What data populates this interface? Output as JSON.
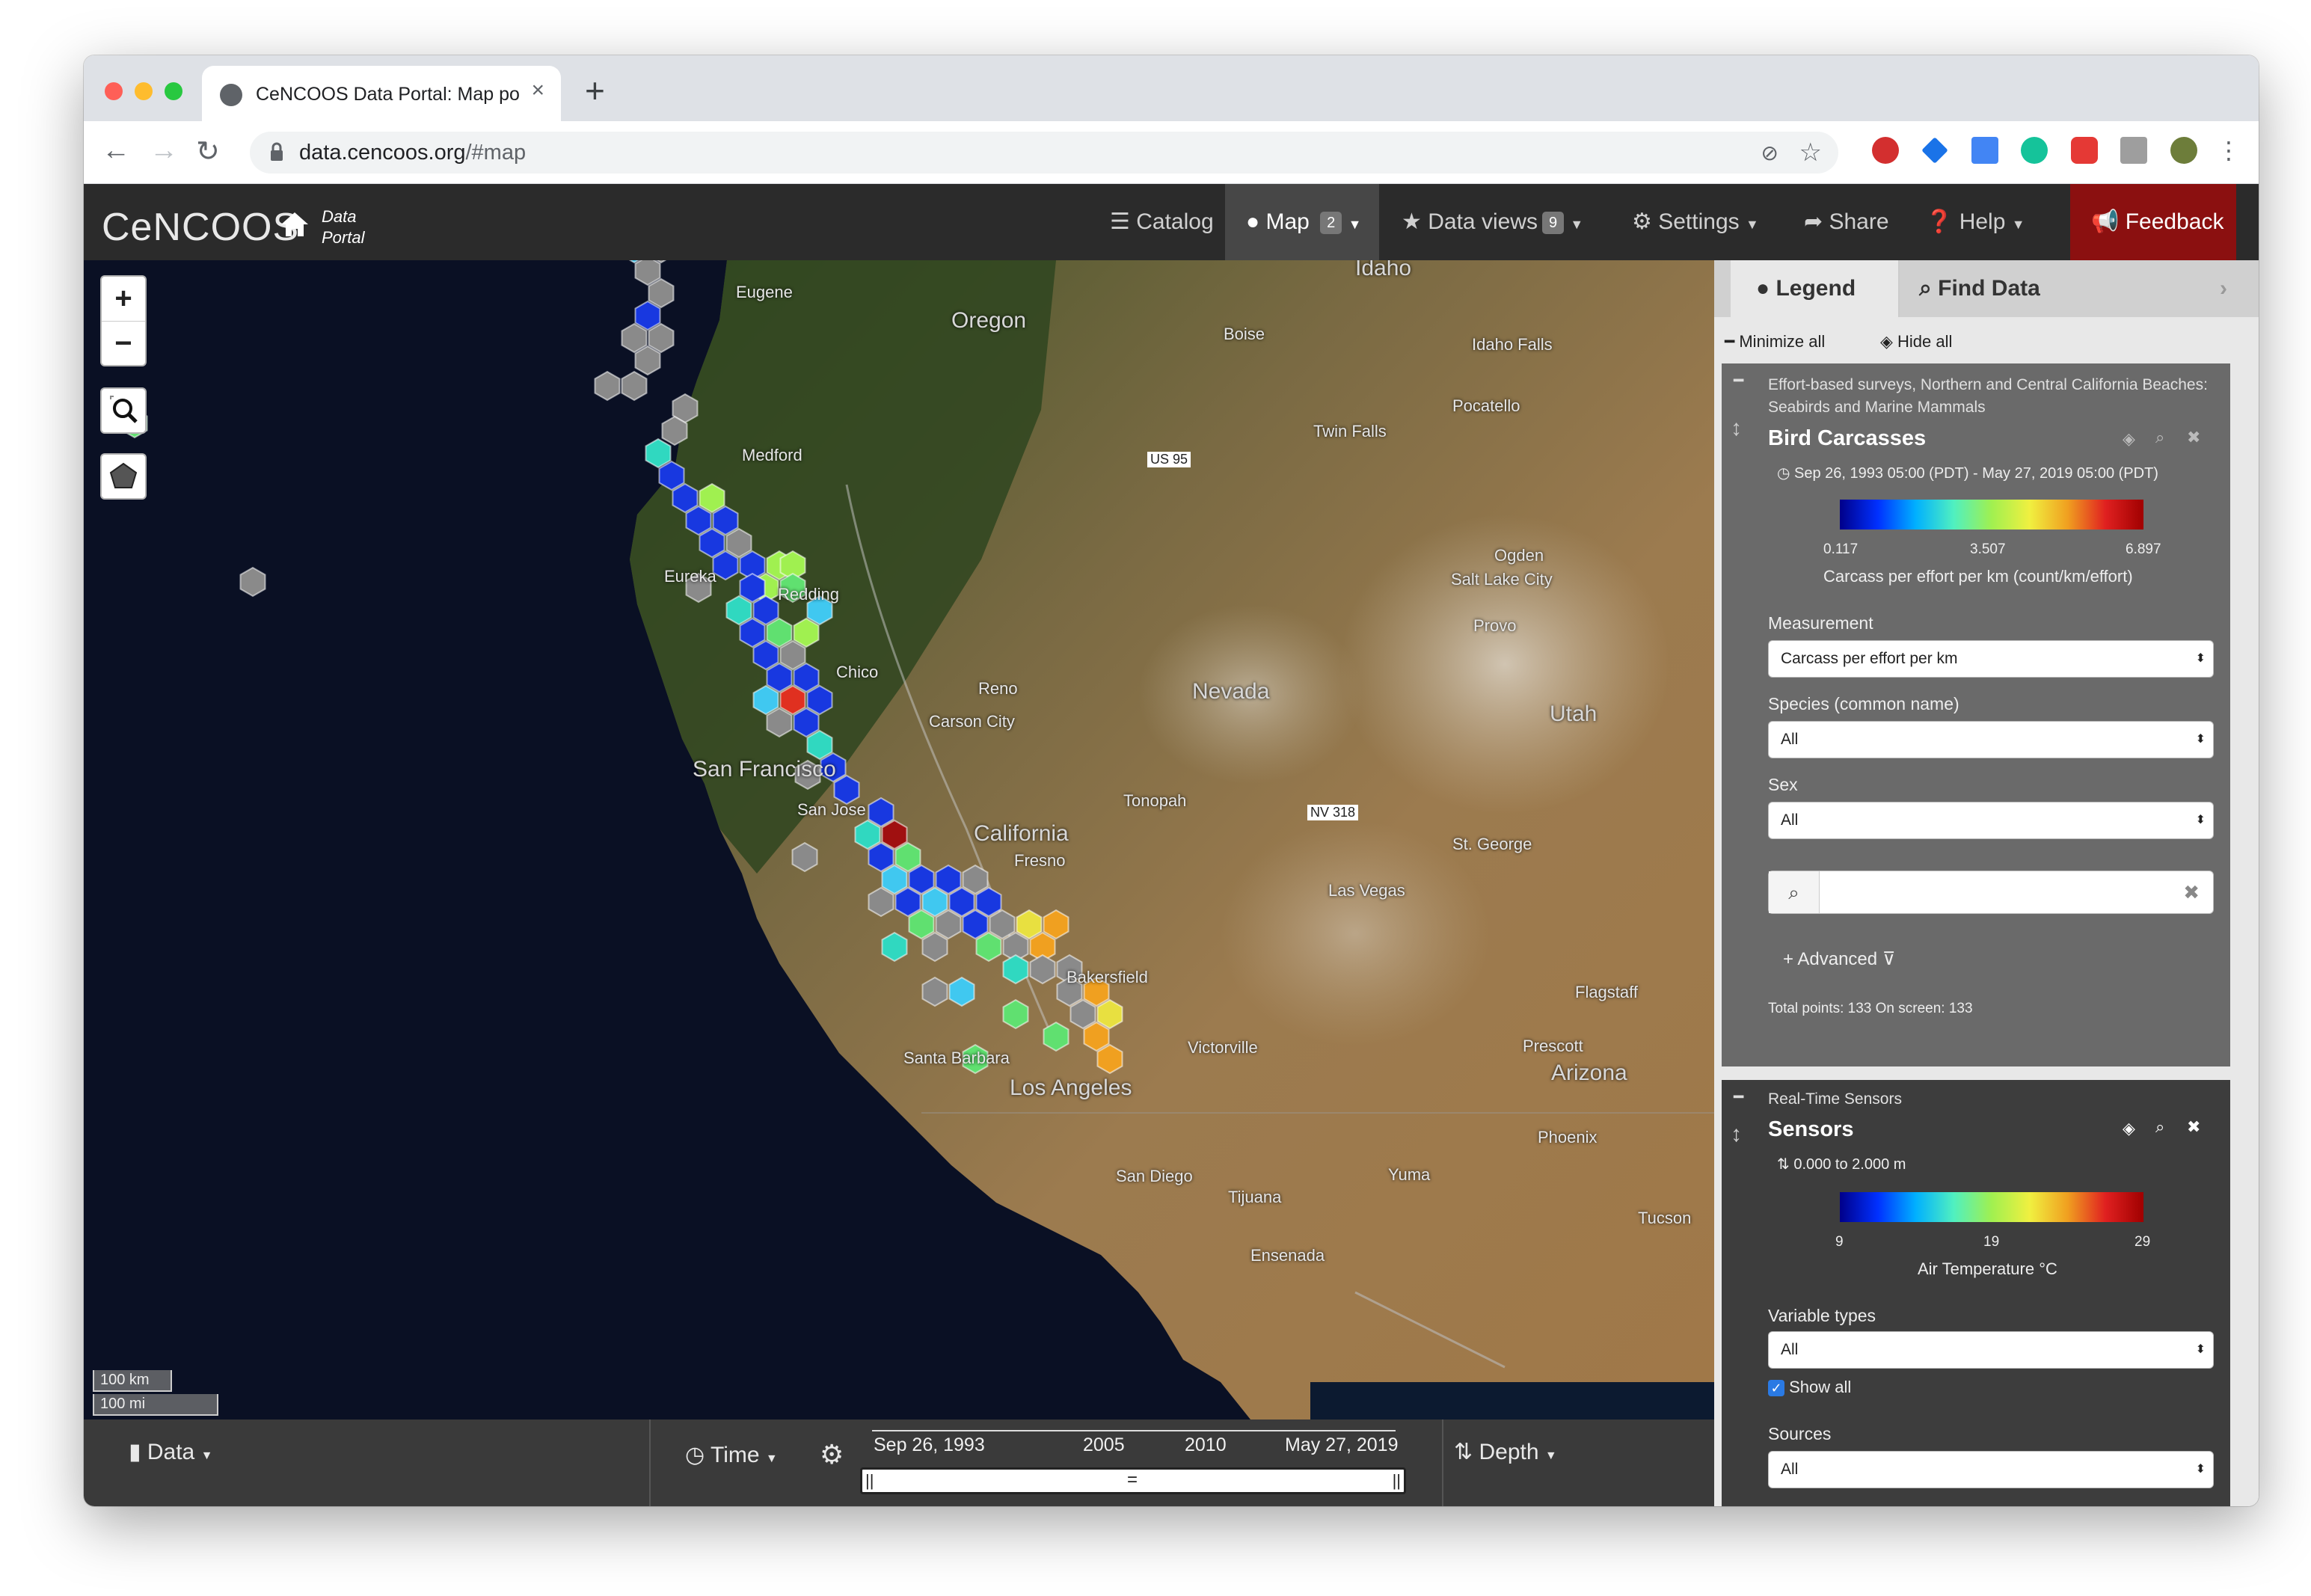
{
  "browser": {
    "tab_title": "CeNCOOS Data Portal: Map po",
    "url_host": "data.cencoos.org",
    "url_path": "/#map"
  },
  "app": {
    "logo": "CeNCOOS",
    "portal_line1": "Data",
    "portal_line2": "Portal",
    "nav": {
      "catalog": "Catalog",
      "map": "Map",
      "map_badge": "2",
      "data_views": "Data views",
      "data_views_badge": "9",
      "settings": "Settings",
      "share": "Share",
      "help": "Help",
      "feedback": "Feedback"
    }
  },
  "map": {
    "labels": {
      "eugene": "Eugene",
      "oregon": "Oregon",
      "boise": "Boise",
      "idaho": "Idaho",
      "idaho_falls": "Idaho Falls",
      "pocatello": "Pocatello",
      "twin_falls": "Twin Falls",
      "us95": "US 95",
      "medford": "Medford",
      "eureka": "Eureka",
      "redding": "Redding",
      "ogden": "Ogden",
      "salt_lake": "Salt Lake City",
      "provo": "Provo",
      "chico": "Chico",
      "reno": "Reno",
      "carson": "Carson City",
      "nevada": "Nevada",
      "utah": "Utah",
      "san_francisco": "San Francisco",
      "san_jose": "San Jose",
      "tonopah": "Tonopah",
      "nv318": "NV 318",
      "california": "California",
      "fresno": "Fresno",
      "st_george": "St. George",
      "las_vegas": "Las Vegas",
      "bakersfield": "Bakersfield",
      "flagstaff": "Flagstaff",
      "prescott": "Prescott",
      "arizona": "Arizona",
      "santa_barbara": "Santa Barbara",
      "victorville": "Victorville",
      "los_angeles": "Los Angeles",
      "phoenix": "Phoenix",
      "san_diego": "San Diego",
      "yuma": "Yuma",
      "tijuana": "Tijuana",
      "ensenada": "Ensenada",
      "tucson": "Tucson"
    },
    "scale_km": "100 km",
    "scale_mi": "100 mi",
    "zoom_in": "+",
    "zoom_out": "−"
  },
  "bottom": {
    "data": "Data",
    "time": "Time",
    "depth": "Depth",
    "ticks": [
      "Sep 26, 1993",
      "2005",
      "2010",
      "May 27, 2019"
    ]
  },
  "panel": {
    "tab_legend": "Legend",
    "tab_find": "Find Data",
    "minimize_all": "Minimize all",
    "hide_all": "Hide all",
    "layer1": {
      "group": "Effort-based surveys, Northern and Central California Beaches: Seabirds and Marine Mammals",
      "title": "Bird Carcasses",
      "time_range": "Sep 26, 1993 05:00 (PDT) - May 27, 2019 05:00 (PDT)",
      "scale_min": "0.117",
      "scale_mid": "3.507",
      "scale_max": "6.897",
      "units": "Carcass per effort per km (count/km/effort)",
      "measurement_label": "Measurement",
      "measurement_value": "Carcass per effort per km",
      "species_label": "Species (common name)",
      "species_value": "All",
      "sex_label": "Sex",
      "sex_value": "All",
      "advanced": "Advanced",
      "totals": "Total points: 133 On screen: 133"
    },
    "layer2": {
      "group": "Real-Time Sensors",
      "title": "Sensors",
      "depth_range": "0.000 to 2.000 m",
      "scale_min": "9",
      "scale_mid": "19",
      "scale_max": "29",
      "units": "Air Temperature °C",
      "variable_label": "Variable types",
      "variable_value": "All",
      "show_all": "Show all",
      "sources_label": "Sources",
      "sources_value": "All"
    }
  }
}
